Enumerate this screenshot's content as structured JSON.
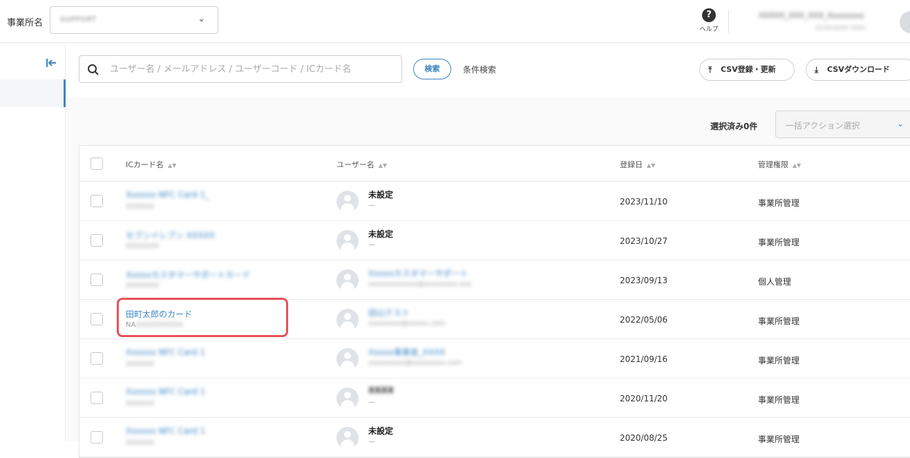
{
  "header": {
    "office_label": "事業所名",
    "office_value": "SUPPORT",
    "help_label": "ヘルプ",
    "user_name": "XXXXX_XXX_XXX_Xxxxxxxx",
    "user_sub": "XX-XX-XXXX XXXX"
  },
  "toolbar": {
    "search_placeholder": "ユーザー名 / メールアドレス / ユーザーコード / ICカード名",
    "search_button": "検索",
    "condition_button": "条件検索",
    "csv_upload": "CSV登録・更新",
    "csv_download": "CSVダウンロード"
  },
  "selection": {
    "count_label": "選択済み0件",
    "bulk_action_placeholder": "一括アクション選択"
  },
  "table": {
    "columns": [
      "ICカード名",
      "ユーザー名",
      "登録日",
      "管理権限"
    ],
    "rows": [
      {
        "card_name": "Xxxxxx NFC Card 1_",
        "card_code": "XXXXXX",
        "user_name": "未設定",
        "user_sub": "—",
        "date": "2023/11/10",
        "permission": "事業所管理"
      },
      {
        "card_name": "セブンイレブン XXXXX",
        "card_code": "XXXXXXX",
        "user_name": "未設定",
        "user_sub": "—",
        "date": "2023/10/27",
        "permission": "事業所管理"
      },
      {
        "card_name": "Xxxxxカスタマーサポートカード",
        "card_code": "XXXXXXX",
        "user_name": "Xxxxxカスタマーサポート",
        "user_sub": "xxxxxxxxxxxx@xxxxxxxx.xxx",
        "date": "2023/09/13",
        "permission": "個人管理"
      },
      {
        "card_name": "田町太郎のカード",
        "card_code": "NAXXXXXXXXXX",
        "user_name": "田山テスト",
        "user_sub": "xxxxxxxx@xxxxx.com",
        "date": "2022/05/06",
        "permission": "事業所管理"
      },
      {
        "card_name": "Xxxxxx NFC Card 1",
        "card_code": "XXXXXX",
        "user_name": "Xxxxx事業者_XXXX",
        "user_sub": "xxxxxxxxx@xxxxxxxx.com",
        "date": "2021/09/16",
        "permission": "事業所管理"
      },
      {
        "card_name": "Xxxxxx NFC Card 1",
        "card_code": "XXXXXX",
        "user_name": "XXXX",
        "user_sub": "—",
        "date": "2020/11/20",
        "permission": "事業所管理"
      },
      {
        "card_name": "Xxxxxx NFC Card 1",
        "card_code": "XXXXXX",
        "user_name": "未設定",
        "user_sub": "—",
        "date": "2020/08/25",
        "permission": "事業所管理"
      }
    ]
  },
  "colors": {
    "accent": "#3b84c4",
    "highlight": "#e8515a"
  }
}
